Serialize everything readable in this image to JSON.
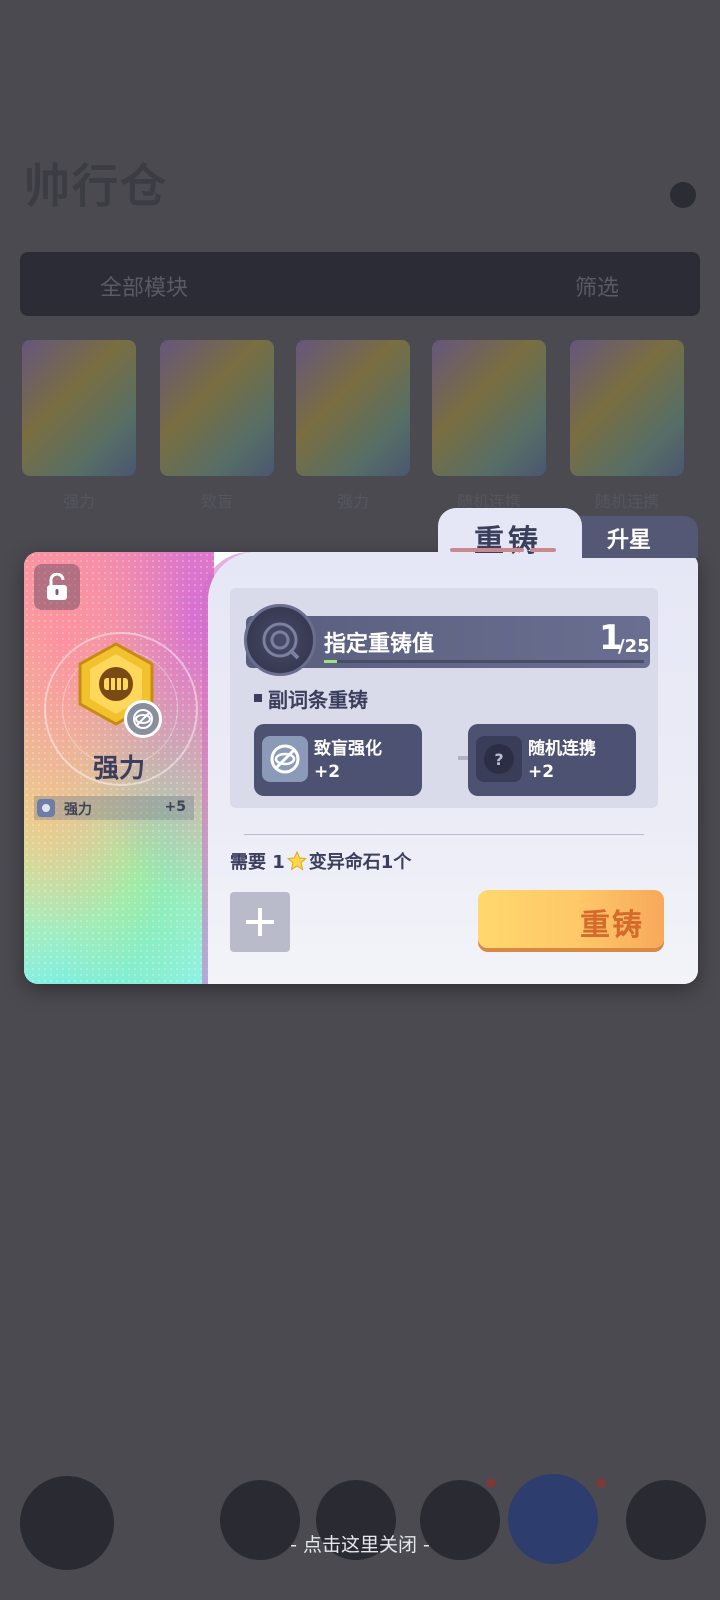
{
  "background": {
    "page_title": "帅行仓",
    "toolbar_text": "全部模块",
    "toolbar_right": "筛选",
    "card_labels": [
      "强力",
      "致盲",
      "强力",
      "随机连携",
      "随机连携"
    ]
  },
  "tabs": {
    "active_label": "重铸",
    "inactive_label": "升星"
  },
  "item": {
    "name": "强力",
    "stat_label": "强力",
    "stat_value": "+5"
  },
  "reforge": {
    "target_label": "指定重铸值",
    "current_value": "1",
    "max_value": "/25",
    "progress": 0.04,
    "section_title": "副词条重铸",
    "from_affix": {
      "name": "致盲强化",
      "value": "+2"
    },
    "to_affix": {
      "name": "随机连携",
      "value": "+2"
    },
    "requirement_prefix": "需要 1",
    "requirement_suffix": "变异命石1个",
    "button_label": "重铸"
  },
  "close_hint": "- 点击这里关闭 -",
  "colors": {
    "accent_gold": "#ffc768",
    "panel_dark": "#4e5272",
    "progress_green": "#9be37c"
  },
  "icons": [
    "lock-open-icon",
    "fist-emblem-icon",
    "blind-eye-icon",
    "arrow-right-icon",
    "question-icon",
    "star-icon",
    "plus-icon"
  ]
}
